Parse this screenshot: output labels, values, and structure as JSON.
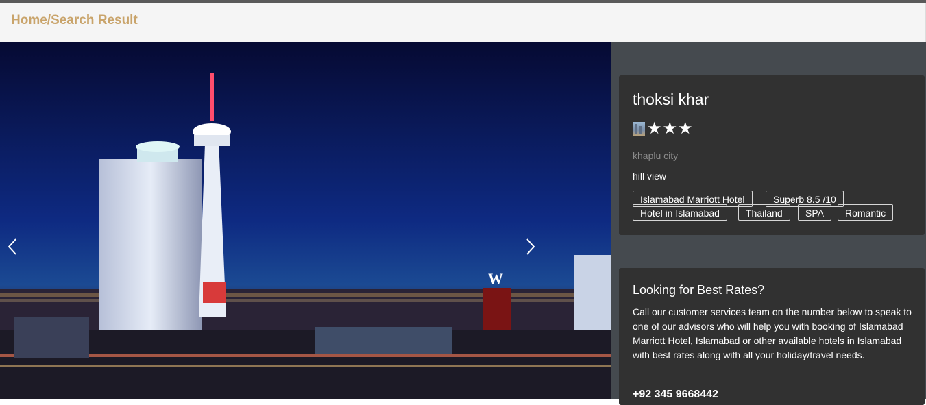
{
  "breadcrumb": {
    "text": "Home/Search Result"
  },
  "colors": {
    "accent": "#c9a46b",
    "sidebar": "#454a4f",
    "card": "#313131"
  },
  "hero": {
    "image": "night city skyline with tower",
    "prev_icon": "chevron-left-icon",
    "next_icon": "chevron-right-icon"
  },
  "hotel": {
    "name": "thoksi khar",
    "rating_stars": 3,
    "star_glyph": "★",
    "city": "khaplu city",
    "view": "hill view",
    "tags": [
      "Islamabad Marriott Hotel",
      "Superb 8.5 /10",
      "Hotel in Islamabad",
      "Thailand",
      "SPA",
      "Romantic"
    ]
  },
  "rates": {
    "title": "Looking for Best Rates?",
    "text": "Call our customer services team on the number below to speak to one of our advisors who will help you with booking of Islamabad Marriott Hotel, Islamabad or other available hotels in Islamabad with best rates along with all your holiday/travel needs.",
    "phone": "+92 345 9668442"
  }
}
